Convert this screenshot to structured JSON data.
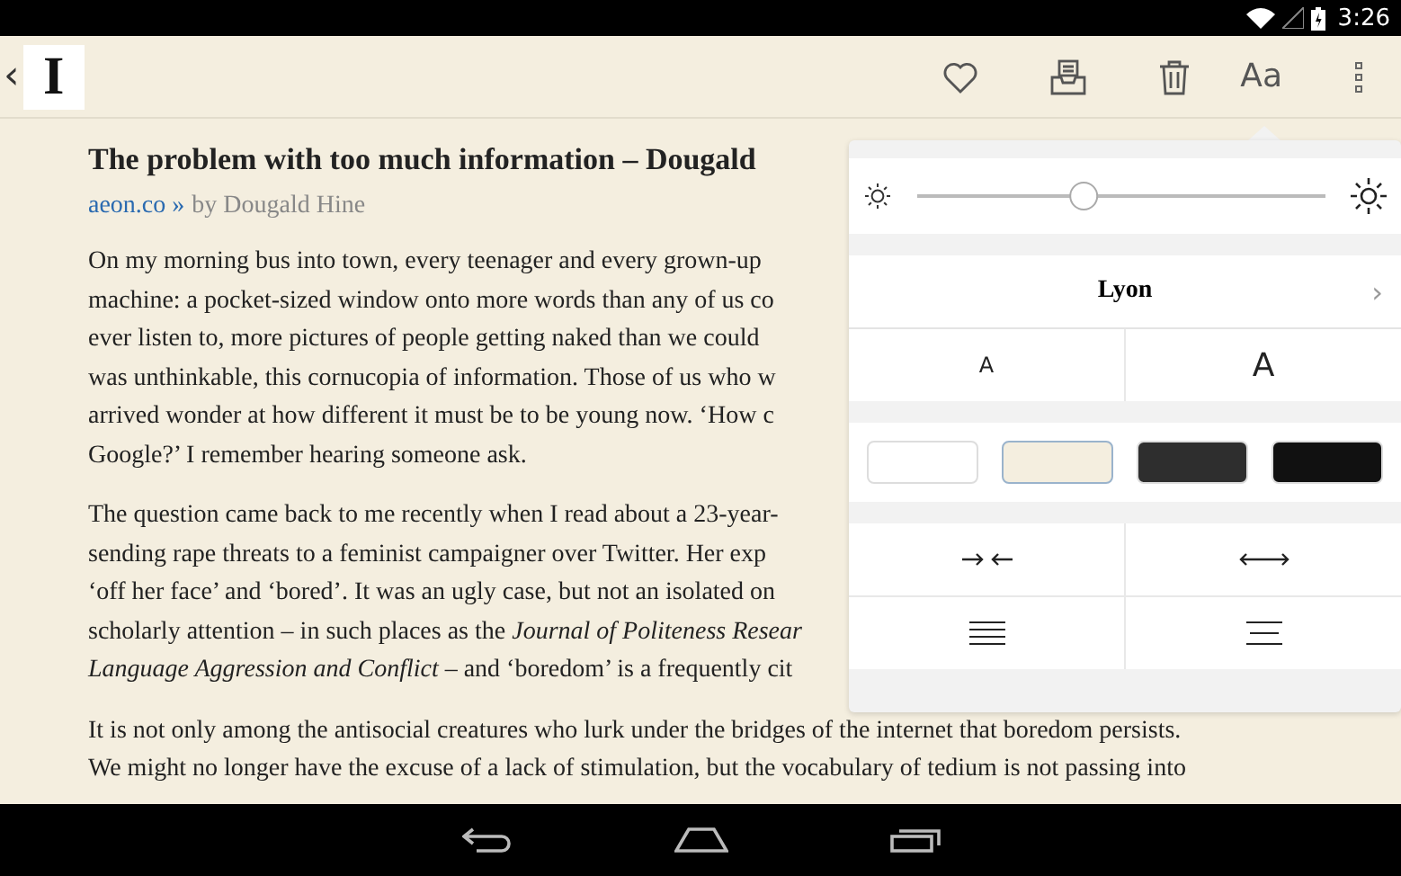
{
  "status_bar": {
    "time": "3:26"
  },
  "toolbar": {
    "back": "‹",
    "logo": "I",
    "text_size_button": "Aa"
  },
  "article": {
    "title": "The problem with too much information – Dougald",
    "site_link": "aeon.co »",
    "byline": "by Dougald Hine",
    "paragraphs": [
      {
        "lines": [
          "On my morning bus into town, every teenager and every grown-up",
          "machine: a pocket-sized window onto more words than any of us co",
          "ever listen to, more pictures of people getting naked than we could",
          "was unthinkable, this cornucopia of information. Those of us who w",
          "arrived wonder at how different it must be to be young now. ‘How c",
          "Google?’ I remember hearing someone ask."
        ]
      },
      {
        "lines": [
          "The question came back to me recently when I read about a 23-year-",
          "sending rape threats to a feminist campaigner over Twitter. Her exp",
          "‘off her face’ and ‘bored’. It was an ugly case, but not an isolated on",
          "scholarly attention – in such places as the *Journal of Politeness Resear*",
          "*Language Aggression and Conflict* – and ‘boredom’ is a frequently cit"
        ]
      },
      {
        "lines": [
          "It is not only among the antisocial creatures who lurk under the bridges of the internet that boredom persists.",
          "We might no longer have the excuse of a lack of stimulation, but the vocabulary of tedium is not passing into"
        ]
      }
    ]
  },
  "settings_popover": {
    "brightness": {
      "level": 0.4
    },
    "font": {
      "name": "Lyon",
      "chevron": "›"
    },
    "size_buttons": [
      {
        "label": "A",
        "kind": "smaller"
      },
      {
        "label": "A",
        "kind": "larger"
      }
    ],
    "themes": [
      {
        "color": "#ffffff",
        "selected": false
      },
      {
        "color": "#f4eedf",
        "selected": true
      },
      {
        "color": "#2e2e2e",
        "selected": false
      },
      {
        "color": "#111111",
        "selected": false
      }
    ],
    "margin_buttons": [
      {
        "kind": "narrow"
      },
      {
        "kind": "wide"
      }
    ],
    "alignment_buttons": [
      {
        "kind": "justified"
      },
      {
        "kind": "centered"
      }
    ]
  }
}
